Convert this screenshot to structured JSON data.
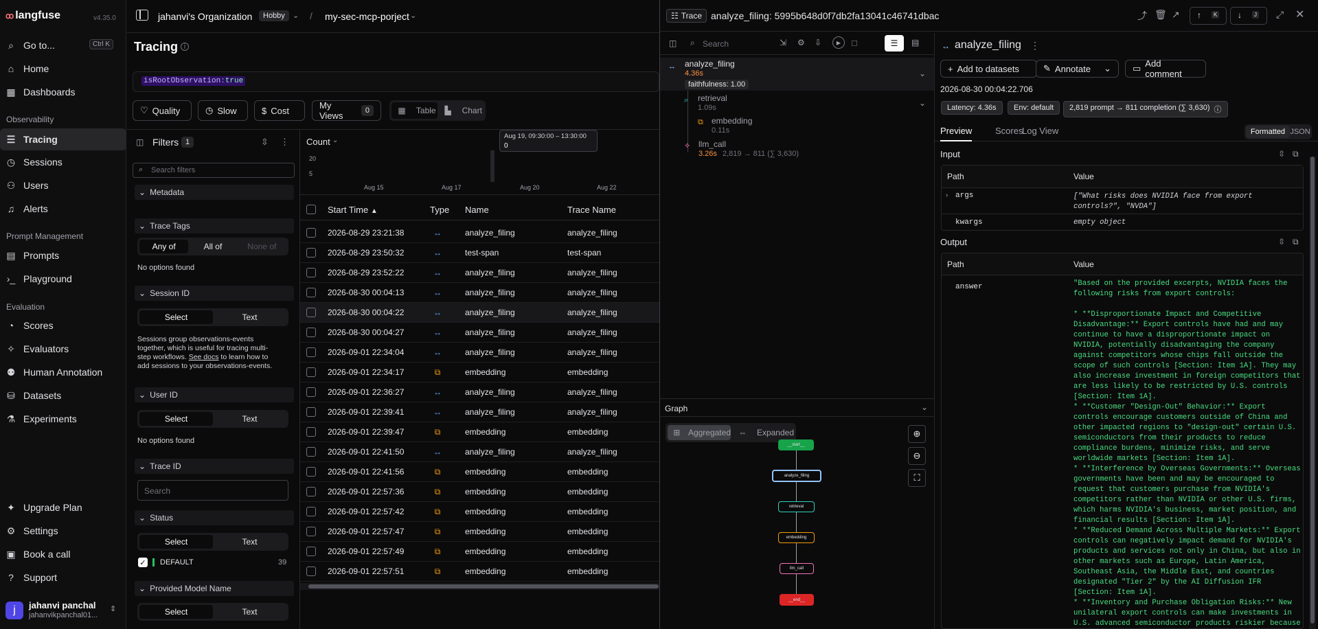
{
  "app": {
    "logo": "langfuse",
    "version": "v4.35.0"
  },
  "sidebar": {
    "goto": {
      "label": "Go to...",
      "shortcut": "Ctrl K"
    },
    "top": [
      {
        "label": "Home",
        "icon": "home-icon"
      },
      {
        "label": "Dashboards",
        "icon": "dashboard-icon"
      }
    ],
    "sections": [
      {
        "title": "Observability",
        "items": [
          {
            "label": "Tracing"
          },
          {
            "label": "Sessions"
          },
          {
            "label": "Users"
          },
          {
            "label": "Alerts"
          }
        ]
      },
      {
        "title": "Prompt Management",
        "items": [
          {
            "label": "Prompts"
          },
          {
            "label": "Playground"
          }
        ]
      },
      {
        "title": "Evaluation",
        "items": [
          {
            "label": "Scores"
          },
          {
            "label": "Evaluators"
          },
          {
            "label": "Human Annotation"
          },
          {
            "label": "Datasets"
          },
          {
            "label": "Experiments"
          }
        ]
      }
    ],
    "bottom": [
      {
        "label": "Upgrade Plan"
      },
      {
        "label": "Settings"
      },
      {
        "label": "Book a call"
      },
      {
        "label": "Support"
      }
    ],
    "user": {
      "initial": "j",
      "name": "jahanvi panchal",
      "email": "jahanvikpanchal01..."
    }
  },
  "topbar": {
    "org": "jahanvi's Organization",
    "plan": "Hobby",
    "project": "my-sec-mcp-porject"
  },
  "tracing": {
    "title": "Tracing",
    "query": {
      "key": "isRootObservation",
      "value": "true"
    },
    "buttons": {
      "quality": "Quality",
      "slow": "Slow",
      "cost": "Cost",
      "views": "My Views",
      "views_count": "0",
      "table": "Table",
      "chart": "Chart"
    },
    "filters": {
      "title": "Filters",
      "count": "1",
      "search_placeholder": "Search filters",
      "metadata": "Metadata",
      "trace_tags": "Trace Tags",
      "any_of": "Any of",
      "all_of": "All of",
      "none_of": "None of",
      "no_options": "No options found",
      "session_id": "Session ID",
      "select": "Select",
      "text": "Text",
      "session_help_1": "Sessions group observations-events",
      "session_help_2": "together, which is useful for tracing multi-",
      "session_help_3": "step workflows.",
      "see_docs": "See docs",
      "session_help_4": " to learn how to",
      "session_help_5": "add sessions to your observations-events.",
      "user_id": "User ID",
      "trace_id": "Trace ID",
      "trace_search": "Search",
      "status": "Status",
      "status_value": "DEFAULT",
      "status_count": "39",
      "provided_model": "Provided Model Name"
    },
    "chart": {
      "title": "Count",
      "y_ticks": [
        "20",
        "5"
      ],
      "x_ticks": [
        "Aug 15",
        "Aug 17",
        "Aug 20",
        "Aug 22"
      ],
      "tooltip_range": "Aug 19, 09:30:00 – 13:30:00",
      "tooltip_value": "0"
    },
    "table": {
      "headers": {
        "start_time": "Start Time",
        "type": "Type",
        "name": "Name",
        "trace_name": "Trace Name"
      },
      "rows": [
        {
          "start": "2026-08-29 23:21:38",
          "type": "trace",
          "name": "analyze_filing",
          "trace": "analyze_filing"
        },
        {
          "start": "2026-08-29 23:50:32",
          "type": "trace",
          "name": "test-span",
          "trace": "test-span"
        },
        {
          "start": "2026-08-29 23:52:22",
          "type": "trace",
          "name": "analyze_filing",
          "trace": "analyze_filing"
        },
        {
          "start": "2026-08-30 00:04:13",
          "type": "trace",
          "name": "analyze_filing",
          "trace": "analyze_filing"
        },
        {
          "start": "2026-08-30 00:04:22",
          "type": "trace",
          "name": "analyze_filing",
          "trace": "analyze_filing"
        },
        {
          "start": "2026-08-30 00:04:27",
          "type": "trace",
          "name": "analyze_filing",
          "trace": "analyze_filing"
        },
        {
          "start": "2026-09-01 22:34:04",
          "type": "trace",
          "name": "analyze_filing",
          "trace": "analyze_filing"
        },
        {
          "start": "2026-09-01 22:34:17",
          "type": "embedding",
          "name": "embedding",
          "trace": "embedding"
        },
        {
          "start": "2026-09-01 22:36:27",
          "type": "trace",
          "name": "analyze_filing",
          "trace": "analyze_filing"
        },
        {
          "start": "2026-09-01 22:39:41",
          "type": "trace",
          "name": "analyze_filing",
          "trace": "analyze_filing"
        },
        {
          "start": "2026-09-01 22:39:47",
          "type": "embedding",
          "name": "embedding",
          "trace": "embedding"
        },
        {
          "start": "2026-09-01 22:41:50",
          "type": "trace",
          "name": "analyze_filing",
          "trace": "analyze_filing"
        },
        {
          "start": "2026-09-01 22:41:56",
          "type": "embedding",
          "name": "embedding",
          "trace": "embedding"
        },
        {
          "start": "2026-09-01 22:57:36",
          "type": "embedding",
          "name": "embedding",
          "trace": "embedding"
        },
        {
          "start": "2026-09-01 22:57:42",
          "type": "embedding",
          "name": "embedding",
          "trace": "embedding"
        },
        {
          "start": "2026-09-01 22:57:47",
          "type": "embedding",
          "name": "embedding",
          "trace": "embedding"
        },
        {
          "start": "2026-09-01 22:57:49",
          "type": "embedding",
          "name": "embedding",
          "trace": "embedding"
        },
        {
          "start": "2026-09-01 22:57:51",
          "type": "embedding",
          "name": "embedding",
          "trace": "embedding"
        }
      ]
    }
  },
  "trace": {
    "tag": "Trace",
    "title": "analyze_filing: 5995b648d0f7db2fa13041c46741dbac",
    "search_placeholder": "Search",
    "tree": {
      "root": {
        "name": "analyze_filing",
        "latency": "4.36s",
        "score": "faithfulness: 1.00"
      },
      "retrieval": {
        "name": "retrieval",
        "latency": "1.09s"
      },
      "embedding": {
        "name": "embedding",
        "latency": "0.11s"
      },
      "llm": {
        "name": "llm_call",
        "latency": "3.26s",
        "tokens": "2,819 → 811 (∑ 3,630)"
      }
    },
    "graph": {
      "title": "Graph",
      "aggregated": "Aggregated",
      "expanded": "Expanded",
      "nodes": [
        "__start__",
        "analyze_filing",
        "retrieval",
        "embedding",
        "llm_call",
        "__end__"
      ]
    },
    "detail": {
      "name": "analyze_filing",
      "add_datasets": "Add to datasets",
      "annotate": "Annotate",
      "add_comment": "Add comment",
      "timestamp": "2026-08-30 00:04:22.706",
      "latency": "Latency: 4.36s",
      "env": "Env: default",
      "tokens": "2,819 prompt → 811 completion (∑ 3,630)",
      "tabs": [
        "Preview",
        "Scores",
        "Log View"
      ],
      "formatted": "Formatted",
      "json": "JSON",
      "input": {
        "title": "Input",
        "path": "Path",
        "value": "Value",
        "args_key": "args",
        "args_val": "[\"What risks does NVIDIA face from export controls?\", \"NVDA\"]",
        "kwargs_key": "kwargs",
        "kwargs_val": "empty object"
      },
      "output": {
        "title": "Output",
        "path": "Path",
        "value": "Value",
        "answer_key": "answer",
        "answer_val": "\"Based on the provided excerpts, NVIDIA faces the following risks from export controls:\n\n* **Disproportionate Impact and Competitive Disadvantage:** Export controls have had and may continue to have a disproportionate impact on NVIDIA, potentially disadvantaging the company against competitors whose chips fall outside the scope of such controls [Section: Item 1A]. They may also increase investment in foreign competitors that are less likely to be restricted by U.S. controls [Section: Item 1A].\n* **Customer \"Design-Out\" Behavior:** Export controls encourage customers outside of China and other impacted regions to \"design-out\" certain U.S. semiconductors from their products to reduce compliance burdens, minimize risks, and serve worldwide markets [Section: Item 1A].\n* **Interference by Overseas Governments:** Overseas governments have been and may be encouraged to request that customers purchase from NVIDIA's competitors rather than NVIDIA or other U.S. firms, which harms NVIDIA's business, market position, and financial results [Section: Item 1A].\n* **Reduced Demand Across Multiple Markets:** Export controls can negatively impact demand for NVIDIA's products and services not only in China, but also in other markets such as Europe, Latin America, Southeast Asia, the Middle East, and countries designated \"Tier 2\" by the AI Diffusion IFR [Section: Item 1A].\n* **Inventory and Purchase Obligation Risks:** New unilateral export controls can make investments in U.S. advanced semiconductor products riskier because"
      }
    }
  }
}
